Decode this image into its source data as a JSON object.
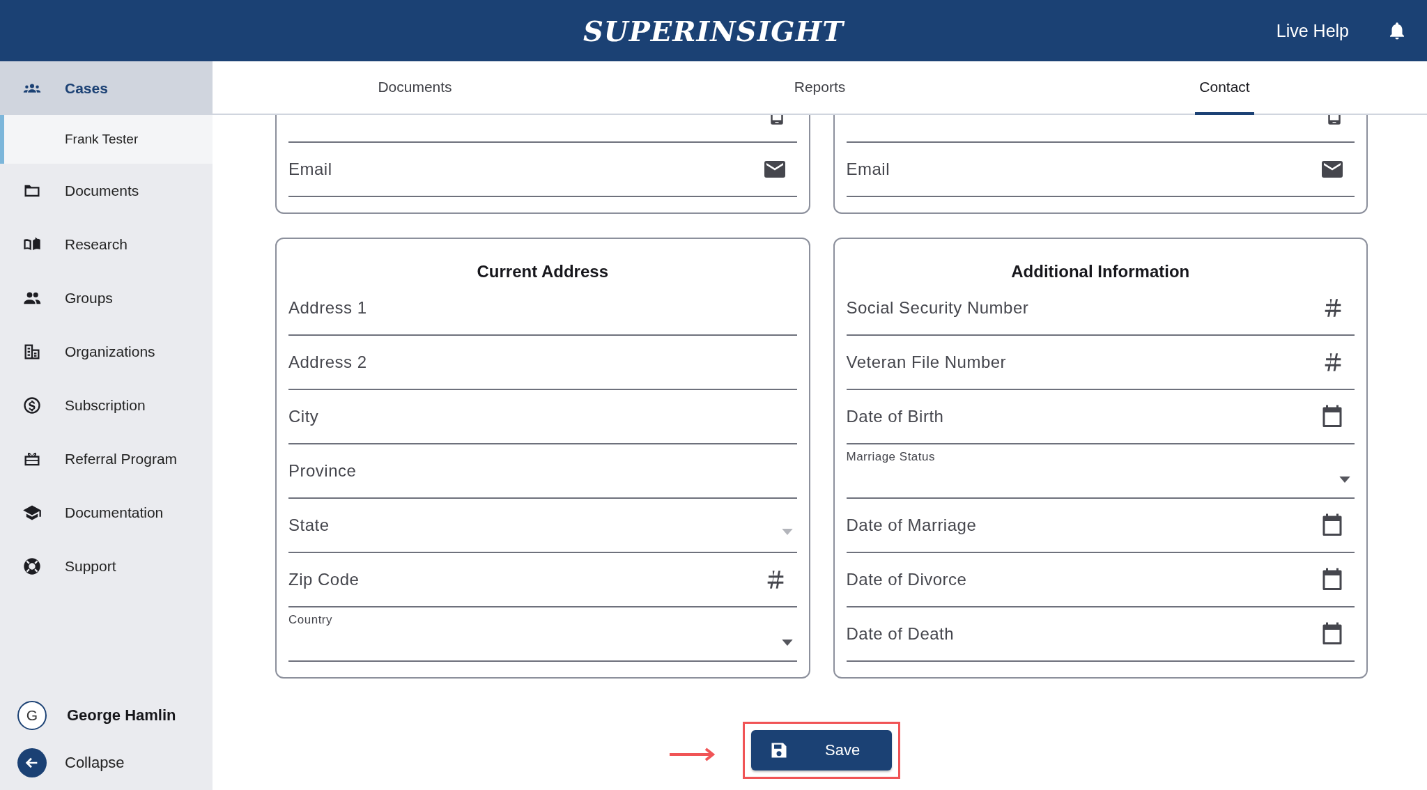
{
  "header": {
    "logo": "SUPERINSIGHT",
    "live_help": "Live Help"
  },
  "sidebar": {
    "items": [
      {
        "label": "Cases",
        "selected": true,
        "children": [
          {
            "label": "Frank Tester",
            "selected": true
          }
        ]
      },
      {
        "label": "Documents",
        "selected": false
      },
      {
        "label": "Research",
        "selected": false
      },
      {
        "label": "Groups",
        "selected": false
      },
      {
        "label": "Organizations",
        "selected": false
      },
      {
        "label": "Subscription",
        "selected": false
      },
      {
        "label": "Referral Program",
        "selected": false
      },
      {
        "label": "Documentation",
        "selected": false
      },
      {
        "label": "Support",
        "selected": false
      }
    ],
    "user": {
      "initial": "G",
      "name": "George Hamlin"
    },
    "collapse": "Collapse"
  },
  "tabs": [
    {
      "label": "Documents",
      "selected": false
    },
    {
      "label": "Reports",
      "selected": false
    },
    {
      "label": "Contact",
      "selected": true
    }
  ],
  "top_cards": [
    {
      "fields": [
        {
          "kind": "phone"
        },
        {
          "label": "Email",
          "kind": "email"
        }
      ]
    },
    {
      "fields": [
        {
          "kind": "phone"
        },
        {
          "label": "Email",
          "kind": "email"
        }
      ]
    }
  ],
  "cards": [
    {
      "title": "Current Address",
      "fields": [
        {
          "label": "Address 1",
          "kind": "text"
        },
        {
          "label": "Address 2",
          "kind": "text"
        },
        {
          "label": "City",
          "kind": "text"
        },
        {
          "label": "Province",
          "kind": "text"
        },
        {
          "label": "State",
          "kind": "select",
          "disabled": true
        },
        {
          "label": "Zip Code",
          "kind": "number"
        },
        {
          "label": "Country",
          "kind": "select",
          "disabled": false
        }
      ]
    },
    {
      "title": "Additional Information",
      "fields": [
        {
          "label": "Social Security Number",
          "kind": "number"
        },
        {
          "label": "Veteran File Number",
          "kind": "number"
        },
        {
          "label": "Date of Birth",
          "kind": "date"
        },
        {
          "label": "Marriage Status",
          "kind": "select",
          "disabled": false
        },
        {
          "label": "Date of Marriage",
          "kind": "date"
        },
        {
          "label": "Date of Divorce",
          "kind": "date"
        },
        {
          "label": "Date of Death",
          "kind": "date"
        }
      ]
    }
  ],
  "save_button": {
    "label": "Save"
  }
}
